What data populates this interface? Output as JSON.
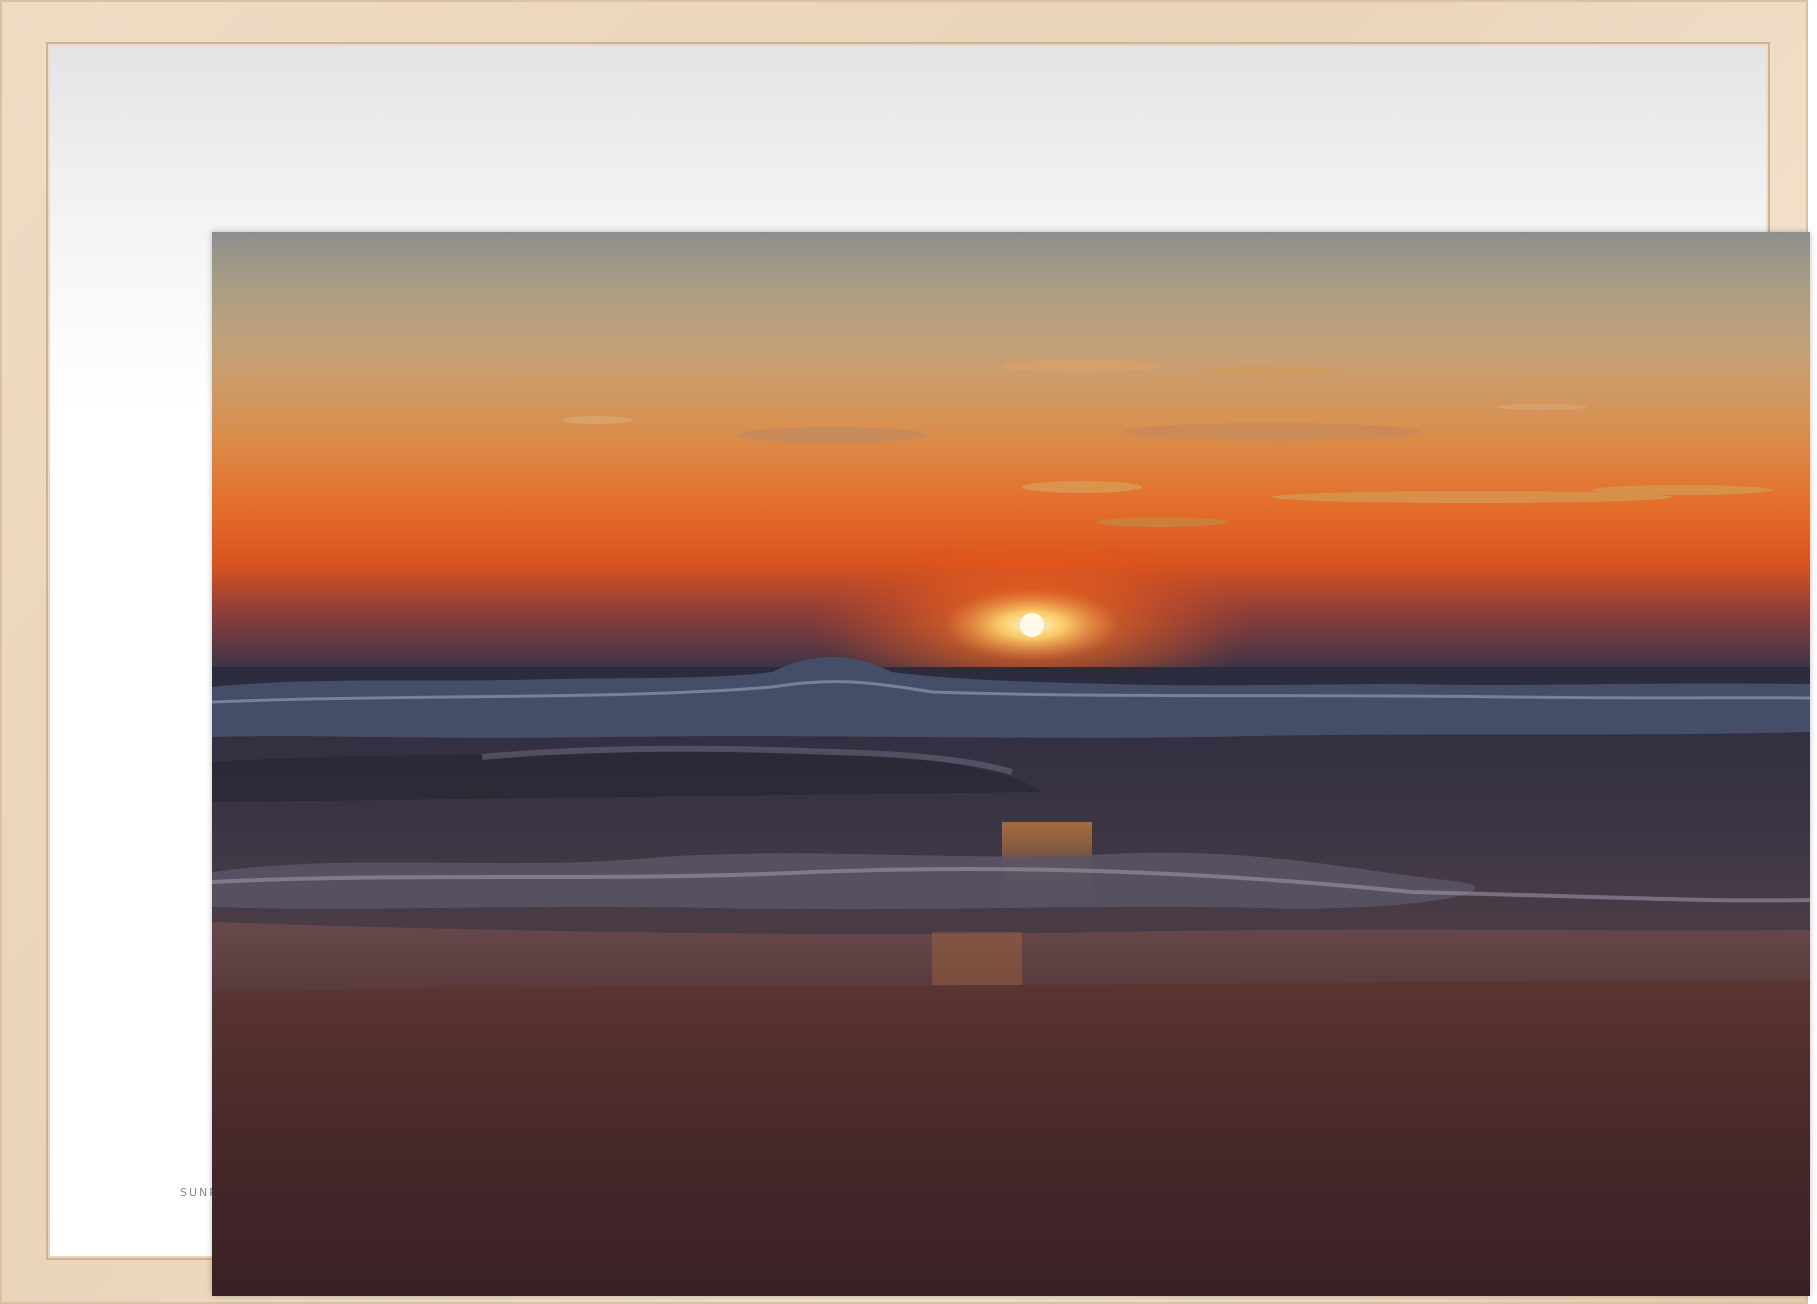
{
  "artwork": {
    "kind": "framed photograph",
    "subject_icon": "sunset-over-ocean",
    "mat_caption": "SUNR"
  },
  "colors": {
    "frame_wood": "#ead5bb",
    "mat": "#ffffff",
    "sky_top": "#8e8d8a",
    "sky_horizon": "#e8501a",
    "sun": "#fffbe8",
    "sea": "#2c2a3a",
    "sand": "#4a2a26"
  }
}
